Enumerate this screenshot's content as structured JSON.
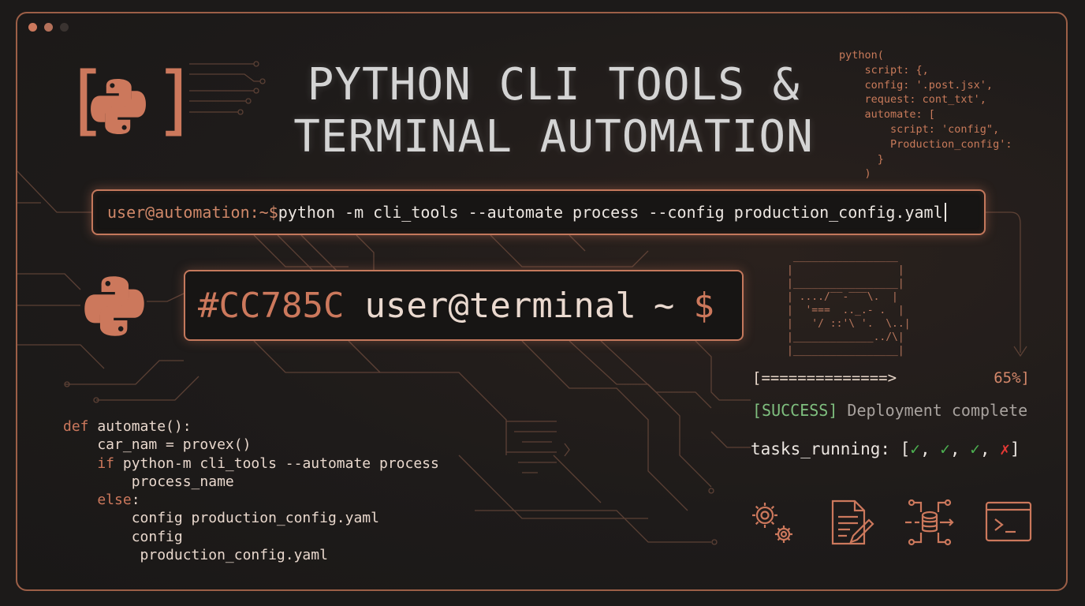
{
  "window": {
    "dot_colors": [
      "#cc785c",
      "#b5715a",
      "#3a3330"
    ]
  },
  "colors": {
    "accent": "#CC785C",
    "success": "#4caf50",
    "error": "#e53935",
    "text": "#e8e2dc"
  },
  "title": {
    "line1": "PYTHON CLI TOOLS &",
    "line2": "TERMINAL AUTOMATION"
  },
  "code_snippet_top": {
    "lines": [
      "python(",
      "    script: {,",
      "    config: '.post.jsx',",
      "    request: cont_txt',",
      "    automate: [",
      "        script: 'config\",",
      "        Production_config':",
      "      }",
      "    )"
    ]
  },
  "command": {
    "prompt": "user@automation:~$",
    "text": " python -m cli_tools --automate process --config production_config.yaml"
  },
  "banner": {
    "hex": "#CC785C",
    "user": "user@terminal",
    "tilde": "~",
    "dollar": "$"
  },
  "ascii_art": {
    "lines": [
      " _________________ ",
      "|                 |",
      "|_________________|",
      "| ..../‾‾-‾‾‾\\.  |",
      "|  '===  .._.- .  |",
      "|   '/ ::'\\ '.  \\..|",
      "|_____________../\\|",
      "|_________________|"
    ]
  },
  "progress": {
    "bar": "[==============>",
    "percent": "65%]",
    "value": 0.65
  },
  "status": {
    "tag": "[SUCCESS]",
    "message": " Deployment complete"
  },
  "tasks": {
    "label": "tasks_running: [",
    "items": [
      "✓",
      ", ",
      "✓",
      ", ",
      "✓",
      ", ",
      "✗"
    ],
    "end": "]"
  },
  "code_snippet_bottom": {
    "lines": [
      {
        "kw": "def",
        "text": " automate():"
      },
      {
        "kw": "",
        "text": "    car_nam = provex()"
      },
      {
        "kw": "    if",
        "text": " python-m cli_tools --automate process"
      },
      {
        "kw": "",
        "text": "        process_name"
      },
      {
        "kw": "    else",
        "text": ":"
      },
      {
        "kw": "",
        "text": "        config production_config.yaml"
      },
      {
        "kw": "",
        "text": "        config"
      },
      {
        "kw": "",
        "text": "         production_config.yaml"
      }
    ]
  },
  "icons": [
    "gear-icon",
    "document-edit-icon",
    "database-flow-icon",
    "terminal-icon"
  ]
}
